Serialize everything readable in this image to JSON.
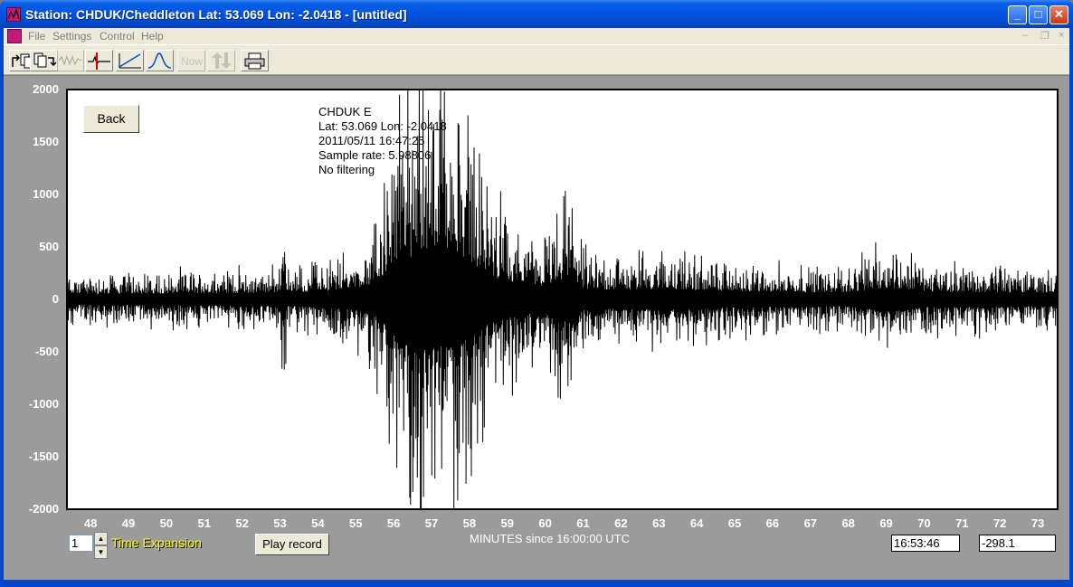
{
  "window": {
    "title": "Station: CHDUK/Cheddleton Lat: 53.069 Lon: -2.0418 - [untitled]",
    "minimize_label": "_",
    "maximize_label": "□",
    "close_label": "✕"
  },
  "menu": {
    "items": [
      "File",
      "Settings",
      "Control",
      "Help"
    ],
    "mdi_min": "–",
    "mdi_restore": "❐",
    "mdi_close": "×"
  },
  "toolbar": {
    "now_label": "Now",
    "icons": [
      "open-file-icon",
      "save-file-icon",
      "waveform-icon",
      "cursor-trace-icon",
      "ramp-icon",
      "peak-icon",
      "now-button",
      "up-down-arrows-icon",
      "printer-icon"
    ]
  },
  "plot": {
    "back_label": "Back",
    "info": {
      "station_channel": "CHDUK  E",
      "latlon": "Lat: 53.069 Lon: -2.0418",
      "datetime": "2011/05/11 16:47:25",
      "sample_rate": "Sample rate: 5.98806",
      "filter": "No filtering"
    },
    "yticks": [
      "2000",
      "1500",
      "1000",
      "500",
      "0",
      "-500",
      "-1000",
      "-1500",
      "-2000"
    ],
    "xticks": [
      "48",
      "49",
      "50",
      "51",
      "52",
      "53",
      "54",
      "55",
      "56",
      "57",
      "58",
      "59",
      "60",
      "61",
      "62",
      "63",
      "64",
      "65",
      "66",
      "67",
      "68",
      "69",
      "70",
      "71",
      "72",
      "73"
    ],
    "xaxis_label": "MINUTES since 16:00:00 UTC"
  },
  "controls": {
    "time_expansion_value": "1",
    "time_expansion_label": "Time Expansion",
    "play_record_label": "Play record",
    "time_readout": "16:53:46",
    "value_readout": "-298.1"
  },
  "colors": {
    "title_bar": "#0053e0",
    "client_bg": "#9b9b9b",
    "plot_bg": "#ffffff",
    "trace": "#000000",
    "time_expansion_text": "#ffff00"
  },
  "chart_data": {
    "type": "line",
    "title": "",
    "xlabel": "MINUTES since 16:00:00 UTC",
    "ylabel": "",
    "xlim": [
      47.4,
      73.5
    ],
    "ylim": [
      -2000,
      2000
    ],
    "grid": false,
    "series": [
      {
        "name": "CHDUK  E",
        "envelope_x": [
          47.4,
          53.0,
          53.1,
          53.2,
          54.0,
          55.0,
          55.5,
          56.0,
          56.2,
          56.5,
          56.7,
          57.0,
          57.3,
          57.6,
          58.0,
          58.5,
          59.0,
          59.5,
          60.0,
          60.7,
          61.0,
          62.0,
          63.0,
          64.0,
          65.0,
          66.0,
          68.0,
          69.0,
          70.0,
          71.0,
          72.0,
          73.5
        ],
        "envelope_amp": [
          200,
          250,
          900,
          250,
          300,
          400,
          600,
          1300,
          1800,
          1600,
          1900,
          1800,
          1800,
          1700,
          1500,
          900,
          700,
          550,
          500,
          900,
          400,
          350,
          400,
          350,
          300,
          280,
          260,
          450,
          300,
          280,
          270,
          250
        ]
      }
    ]
  }
}
